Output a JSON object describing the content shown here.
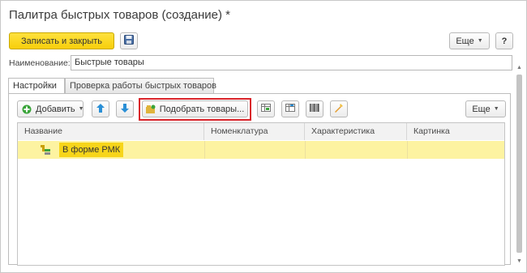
{
  "window": {
    "title": "Палитра быстрых товаров (создание) *"
  },
  "toolbar": {
    "save_close_label": "Записать и закрыть",
    "more_label": "Еще",
    "help_label": "?"
  },
  "form": {
    "name_label": "Наименование:",
    "name_value": "Быстрые товары"
  },
  "tabs": [
    {
      "label": "Настройки",
      "active": true
    },
    {
      "label": "Проверка работы быстрых товаров",
      "active": false
    }
  ],
  "items_toolbar": {
    "add_label": "Добавить",
    "pick_label": "Подобрать товары...",
    "more_label": "Еще"
  },
  "table": {
    "columns": [
      "Название",
      "Номенклатура",
      "Характеристика",
      "Картинка"
    ],
    "rows": [
      {
        "name": "В форме РМК",
        "nomenclature": "",
        "characteristic": "",
        "picture": ""
      }
    ]
  },
  "colors": {
    "accent_yellow": "#f7cf0a",
    "selected_row": "#fdf3a1",
    "highlight_frame": "#d9242a",
    "arrow_blue": "#2a8fd6",
    "add_green": "#3aa43a"
  },
  "icons": [
    "save-icon",
    "add-icon",
    "move-up-icon",
    "move-down-icon",
    "pick-items-icon",
    "tool-icon",
    "folder-group-icon"
  ]
}
